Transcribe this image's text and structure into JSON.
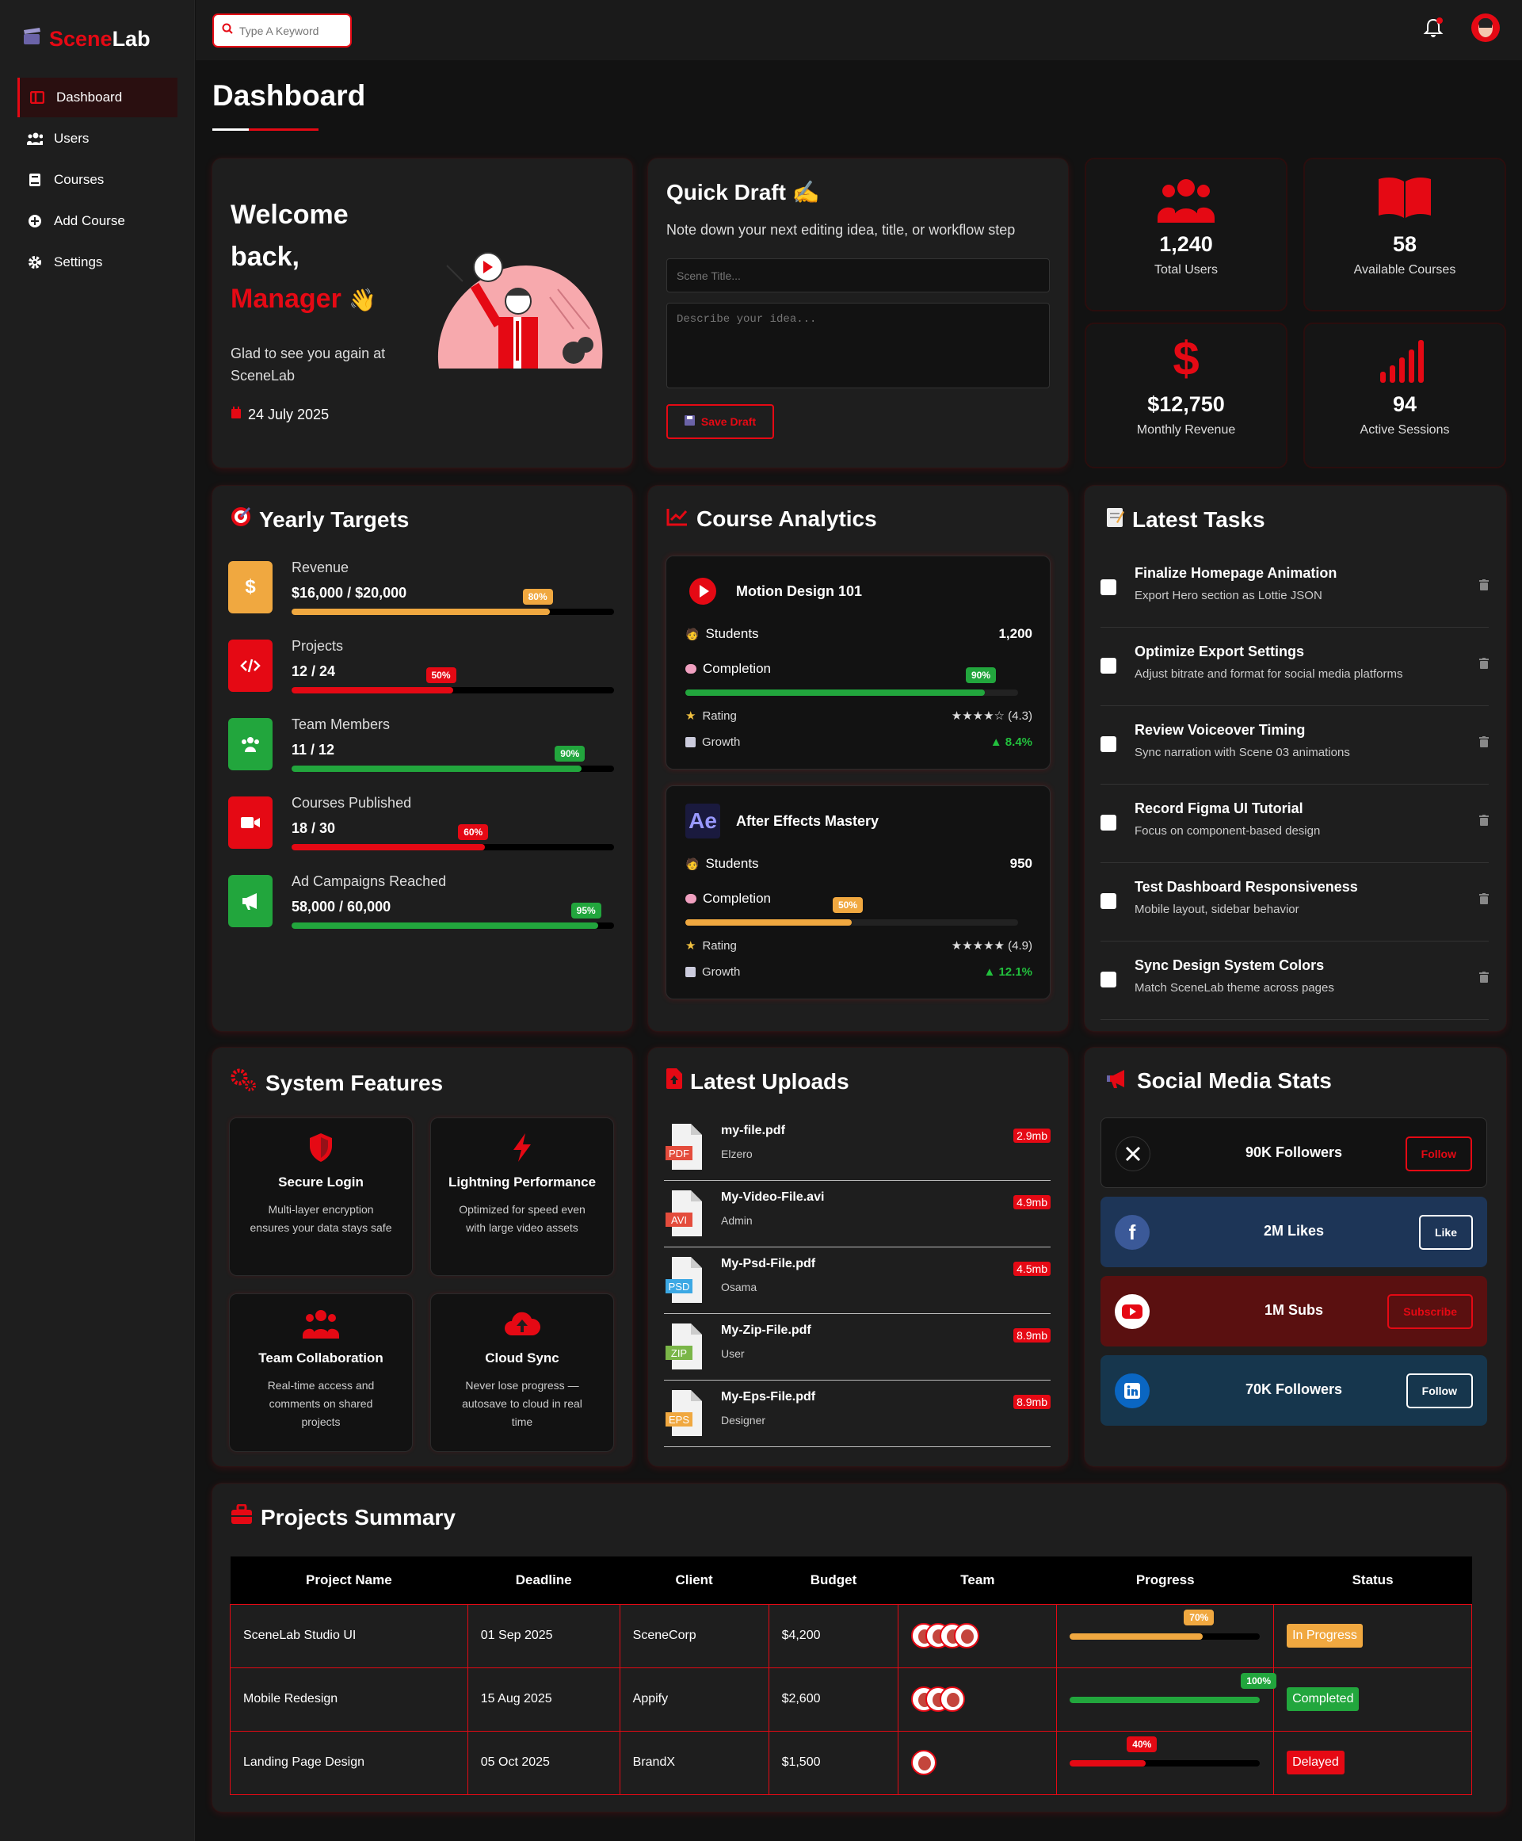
{
  "app": {
    "brand_part1": "Scene",
    "brand_part2": "Lab"
  },
  "sidebar": {
    "items": [
      {
        "label": "Dashboard",
        "icon": "dashboard-icon"
      },
      {
        "label": "Users",
        "icon": "users-icon"
      },
      {
        "label": "Courses",
        "icon": "book-icon"
      },
      {
        "label": "Add Course",
        "icon": "plus-circle-icon"
      },
      {
        "label": "Settings",
        "icon": "gear-icon"
      }
    ]
  },
  "topbar": {
    "search_placeholder": "Type A Keyword"
  },
  "page": {
    "title": "Dashboard"
  },
  "welcome": {
    "line1": "Welcome",
    "line2": "back,",
    "name": "Manager",
    "wave": "👋",
    "message": "Glad to see you again at SceneLab",
    "date": "24 July 2025"
  },
  "draft": {
    "title": "Quick Draft ✍️",
    "subtitle": "Note down your next editing idea, title, or workflow step",
    "title_placeholder": "Scene Title...",
    "idea_placeholder": "Describe your idea...",
    "save_label": "Save Draft"
  },
  "stats": [
    {
      "value": "1,240",
      "label": "Total Users"
    },
    {
      "value": "58",
      "label": "Available Courses"
    },
    {
      "value": "$12,750",
      "label": "Monthly Revenue"
    },
    {
      "value": "94",
      "label": "Active Sessions"
    }
  ],
  "targets": {
    "title": "Yearly Targets",
    "items": [
      {
        "label": "Revenue",
        "value": "$16,000 / $20,000",
        "percent": 80,
        "badge": "80%",
        "color": "#f0a840"
      },
      {
        "label": "Projects",
        "value": "12 / 24",
        "percent": 50,
        "badge": "50%",
        "color": "#e50914"
      },
      {
        "label": "Team Members",
        "value": "11 / 12",
        "percent": 90,
        "badge": "90%",
        "color": "#22a63d"
      },
      {
        "label": "Courses Published",
        "value": "18 / 30",
        "percent": 60,
        "badge": "60%",
        "color": "#e50914"
      },
      {
        "label": "Ad Campaigns Reached",
        "value": "58,000 / 60,000",
        "percent": 95,
        "badge": "95%",
        "color": "#22a63d"
      }
    ]
  },
  "analytics": {
    "title": "Course Analytics",
    "students_label": "Students",
    "completion_label": "Completion",
    "rating_label": "Rating",
    "growth_label": "Growth",
    "courses": [
      {
        "name": "Motion Design 101",
        "students": "1,200",
        "completion": 90,
        "completion_badge": "90%",
        "rating": "★★★★☆ (4.3)",
        "growth": "▲ 8.4%",
        "color": "#22a63d"
      },
      {
        "name": "After Effects Mastery",
        "icon_text": "Ae",
        "students": "950",
        "completion": 50,
        "completion_badge": "50%",
        "rating": "★★★★★ (4.9)",
        "growth": "▲ 12.1%",
        "color": "#f0a840"
      }
    ]
  },
  "tasks": {
    "title": "Latest Tasks",
    "items": [
      {
        "title": "Finalize Homepage Animation",
        "desc": "Export Hero section as Lottie JSON"
      },
      {
        "title": "Optimize Export Settings",
        "desc": "Adjust bitrate and format for social media platforms"
      },
      {
        "title": "Review Voiceover Timing",
        "desc": "Sync narration with Scene 03 animations"
      },
      {
        "title": "Record Figma UI Tutorial",
        "desc": "Focus on component-based design"
      },
      {
        "title": "Test Dashboard Responsiveness",
        "desc": "Mobile layout, sidebar behavior"
      },
      {
        "title": "Sync Design System Colors",
        "desc": "Match SceneLab theme across pages"
      }
    ]
  },
  "features": {
    "title": "System Features",
    "items": [
      {
        "title": "Secure Login",
        "desc": "Multi-layer encryption ensures your data stays safe"
      },
      {
        "title": "Lightning Performance",
        "desc": "Optimized for speed even with large video assets"
      },
      {
        "title": "Team Collaboration",
        "desc": "Real-time access and comments on shared projects"
      },
      {
        "title": "Cloud Sync",
        "desc": "Never lose progress — autosave to cloud in real time"
      }
    ]
  },
  "uploads": {
    "title": "Latest Uploads",
    "items": [
      {
        "name": "my-file.pdf",
        "user": "Elzero",
        "size": "2.9mb",
        "type": "PDF",
        "color": "#e44c3c"
      },
      {
        "name": "My-Video-File.avi",
        "user": "Admin",
        "size": "4.9mb",
        "type": "AVI",
        "color": "#e44c3c"
      },
      {
        "name": "My-Psd-File.pdf",
        "user": "Osama",
        "size": "4.5mb",
        "type": "PSD",
        "color": "#3ca8e4"
      },
      {
        "name": "My-Zip-File.pdf",
        "user": "User",
        "size": "8.9mb",
        "type": "ZIP",
        "color": "#7ab648"
      },
      {
        "name": "My-Eps-File.pdf",
        "user": "Designer",
        "size": "8.9mb",
        "type": "EPS",
        "color": "#f0a840"
      }
    ]
  },
  "social": {
    "title": "Social Media Stats",
    "items": [
      {
        "text": "90K Followers",
        "button": "Follow",
        "icon": "x-icon",
        "bg": "#121212",
        "btn_color": "#e50914"
      },
      {
        "text": "2M Likes",
        "button": "Like",
        "icon": "facebook-icon",
        "bg": "#1d3557",
        "btn_color": "#ffffff"
      },
      {
        "text": "1M Subs",
        "button": "Subscribe",
        "icon": "youtube-icon",
        "bg": "#5a1010",
        "btn_color": "#e50914"
      },
      {
        "text": "70K Followers",
        "button": "Follow",
        "icon": "linkedin-icon",
        "bg": "#16364d",
        "btn_color": "#ffffff"
      }
    ]
  },
  "projects": {
    "title": "Projects Summary",
    "headers": [
      "Project Name",
      "Deadline",
      "Client",
      "Budget",
      "Team",
      "Progress",
      "Status"
    ],
    "rows": [
      {
        "name": "SceneLab Studio UI",
        "deadline": "01 Sep 2025",
        "client": "SceneCorp",
        "budget": "$4,200",
        "team": 4,
        "progress": 70,
        "progress_label": "70%",
        "status": "In Progress",
        "color": "#f0a840"
      },
      {
        "name": "Mobile Redesign",
        "deadline": "15 Aug 2025",
        "client": "Appify",
        "budget": "$2,600",
        "team": 3,
        "progress": 100,
        "progress_label": "100%",
        "status": "Completed",
        "color": "#22a63d"
      },
      {
        "name": "Landing Page Design",
        "deadline": "05 Oct 2025",
        "client": "BrandX",
        "budget": "$1,500",
        "team": 1,
        "progress": 40,
        "progress_label": "40%",
        "status": "Delayed",
        "color": "#e50914"
      }
    ]
  }
}
